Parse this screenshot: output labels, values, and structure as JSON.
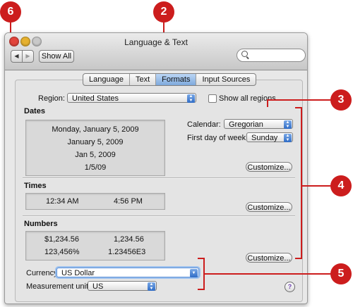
{
  "window": {
    "title": "Language & Text",
    "toolbar": {
      "back_icon": "◀",
      "forward_icon": "▶",
      "show_all_label": "Show All",
      "search_placeholder": ""
    }
  },
  "tabs": [
    {
      "label": "Language",
      "selected": false
    },
    {
      "label": "Text",
      "selected": false
    },
    {
      "label": "Formats",
      "selected": true
    },
    {
      "label": "Input Sources",
      "selected": false
    }
  ],
  "region": {
    "label": "Region:",
    "value": "United States",
    "show_all_label": "Show all regions",
    "show_all_checked": false
  },
  "dates": {
    "heading": "Dates",
    "samples": [
      "Monday, January 5, 2009",
      "January 5, 2009",
      "Jan 5, 2009",
      "1/5/09"
    ],
    "calendar_label": "Calendar:",
    "calendar_value": "Gregorian",
    "first_day_label": "First day of week:",
    "first_day_value": "Sunday",
    "customize_label": "Customize..."
  },
  "times": {
    "heading": "Times",
    "samples": [
      "12:34 AM",
      "4:56 PM"
    ],
    "customize_label": "Customize..."
  },
  "numbers": {
    "heading": "Numbers",
    "samples": [
      "$1,234.56",
      "1,234.56",
      "123,456%",
      "1.23456E3"
    ],
    "customize_label": "Customize..."
  },
  "currency": {
    "label": "Currency:",
    "value": "US Dollar"
  },
  "measurement": {
    "label": "Measurement units:",
    "value": "US"
  },
  "help_icon": "?",
  "callouts": [
    "6",
    "2",
    "3",
    "4",
    "5"
  ],
  "colors": {
    "callout_red": "#cc1d1d",
    "selected_tab_blue": "#7ea9dc",
    "popup_arrow_blue": "#2f6cc6"
  }
}
